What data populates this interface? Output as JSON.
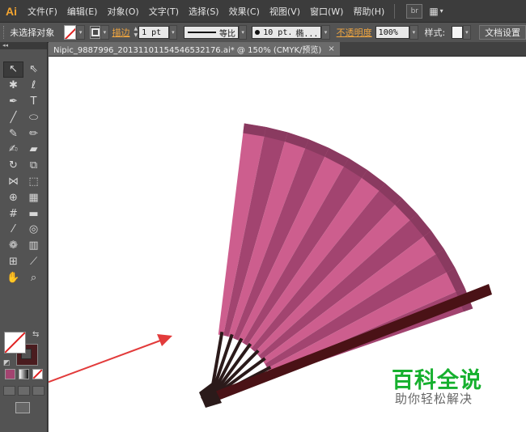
{
  "menubar": {
    "app_logo": "Ai",
    "items": [
      "文件(F)",
      "编辑(E)",
      "对象(O)",
      "文字(T)",
      "选择(S)",
      "效果(C)",
      "视图(V)",
      "窗口(W)",
      "帮助(H)"
    ],
    "bridge_icon": "br"
  },
  "controlbar": {
    "selection_label": "未选择对象",
    "stroke_link": "描边",
    "stroke_weight": "1 pt",
    "profile_label": "等比",
    "brush_size": "10 pt.",
    "brush_name": "椭...",
    "opacity_link": "不透明度",
    "opacity_value": "100%",
    "style_label": "样式:",
    "doc_setup_button": "文档设置"
  },
  "document": {
    "tab_title": "Nipic_9887996_20131101154546532176.ai* @ 150% (CMYK/预览)",
    "close_glyph": "×"
  },
  "toolbox": {
    "collapse_glyph": "◂◂",
    "tools": [
      {
        "name": "selection-tool-icon",
        "glyph": "↖",
        "selected": true
      },
      {
        "name": "direct-selection-tool-icon",
        "glyph": "⇖"
      },
      {
        "name": "magic-wand-tool-icon",
        "glyph": "✱"
      },
      {
        "name": "lasso-tool-icon",
        "glyph": "ℓ"
      },
      {
        "name": "pen-tool-icon",
        "glyph": "✒"
      },
      {
        "name": "type-tool-icon",
        "glyph": "T"
      },
      {
        "name": "line-segment-tool-icon",
        "glyph": "╱"
      },
      {
        "name": "ellipse-tool-icon",
        "glyph": "⬭"
      },
      {
        "name": "paintbrush-tool-icon",
        "glyph": "✎"
      },
      {
        "name": "pencil-tool-icon",
        "glyph": "✏"
      },
      {
        "name": "blob-brush-tool-icon",
        "glyph": "✍"
      },
      {
        "name": "eraser-tool-icon",
        "glyph": "▰"
      },
      {
        "name": "rotate-tool-icon",
        "glyph": "↻"
      },
      {
        "name": "scale-tool-icon",
        "glyph": "⧉"
      },
      {
        "name": "width-tool-icon",
        "glyph": "⋈"
      },
      {
        "name": "free-transform-tool-icon",
        "glyph": "⬚"
      },
      {
        "name": "shape-builder-tool-icon",
        "glyph": "⊕"
      },
      {
        "name": "perspective-grid-tool-icon",
        "glyph": "▦"
      },
      {
        "name": "mesh-tool-icon",
        "glyph": "#"
      },
      {
        "name": "gradient-tool-icon",
        "glyph": "▬"
      },
      {
        "name": "eyedropper-tool-icon",
        "glyph": "⁄"
      },
      {
        "name": "blend-tool-icon",
        "glyph": "◎"
      },
      {
        "name": "symbol-sprayer-tool-icon",
        "glyph": "❁"
      },
      {
        "name": "column-graph-tool-icon",
        "glyph": "▥"
      },
      {
        "name": "artboard-tool-icon",
        "glyph": "⊞"
      },
      {
        "name": "slice-tool-icon",
        "glyph": "⟋"
      },
      {
        "name": "hand-tool-icon",
        "glyph": "✋"
      },
      {
        "name": "zoom-tool-icon",
        "glyph": "⌕"
      }
    ],
    "swap_glyph": "⇆",
    "default_glyph": "◩"
  },
  "watermark": {
    "title": "百科全说",
    "subtitle": "助你轻松解决"
  },
  "colors": {
    "fan_light": "#cd5e8e",
    "fan_dark": "#a24470",
    "fan_edge": "#8a3a60",
    "rib": "#2b1a1a",
    "guard": "#4a1216",
    "arrow": "#e23b3b",
    "watermark_green": "#16b02e"
  }
}
